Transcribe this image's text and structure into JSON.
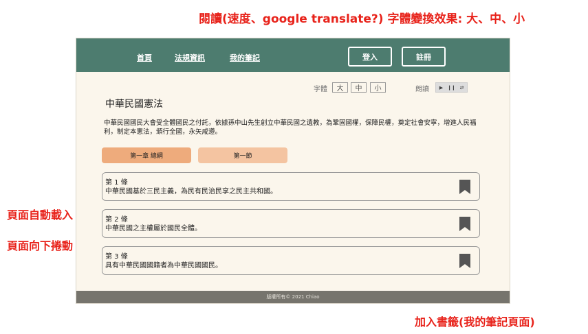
{
  "annotations": {
    "top": "閱讀(速度、google translate?)  字體變換效果: 大、中、小",
    "left_1": "頁面自動載入",
    "left_2": "頁面向下捲動",
    "bottom": "加入書籤(我的筆記頁面)"
  },
  "nav": {
    "links": [
      "首頁",
      "法規資訊",
      "我的筆記"
    ],
    "login_label": "登入",
    "register_label": "註冊"
  },
  "toolbar": {
    "font_size_label": "字體",
    "font_sizes": [
      "大",
      "中",
      "小"
    ],
    "read_aloud_label": "朗讀",
    "audio_controls": [
      "play-icon",
      "pause-icon",
      "shuffle-icon"
    ]
  },
  "law": {
    "title": "中華民國憲法",
    "preamble": "中華民國國民大會受全體國民之付託，依據孫中山先生創立中華民國之遺教，為鞏固國權，保障民權，奠定社會安寧，增進人民福利，制定本憲法，頒行全國，永矢咸遵。"
  },
  "chapters": [
    {
      "label": "第一章 總綱",
      "color": "#eeab7c"
    },
    {
      "label": "第一節",
      "color": "#f4c4a1"
    }
  ],
  "articles": [
    {
      "number": "第 1 條",
      "text": "中華民國基於三民主義，為民有民治民享之民主共和國。"
    },
    {
      "number": "第 2 條",
      "text": "中華民國之主權屬於國民全體。"
    },
    {
      "number": "第 3 條",
      "text": "具有中華民國國籍者為中華民國國民。"
    }
  ],
  "footer": {
    "text": "版權所有© 2021 Chiao"
  },
  "colors": {
    "navbar": "#4d7c6f",
    "annotation": "#e8231b",
    "page_bg": "#fbf6ec",
    "footer_bg": "#76746d",
    "bookmark": "#555555"
  }
}
